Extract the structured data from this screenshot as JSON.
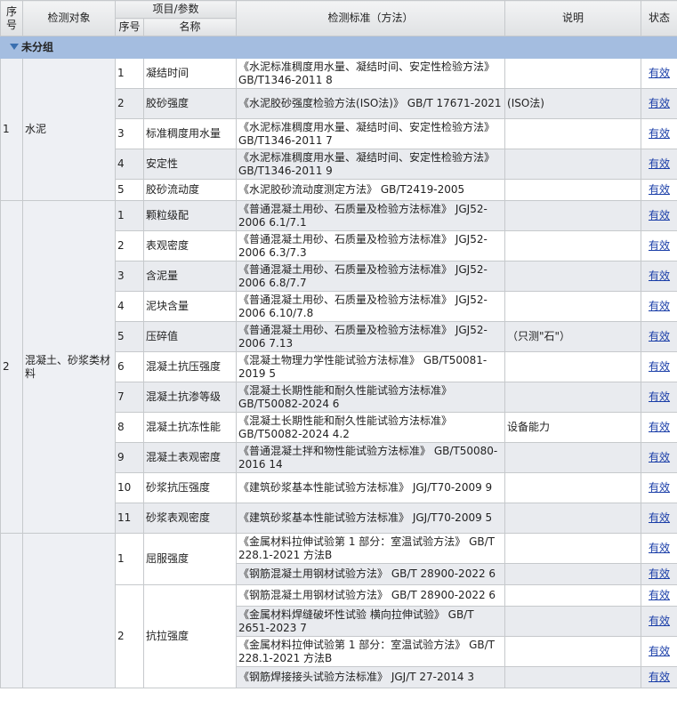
{
  "headers": {
    "seq": "序号",
    "object": "检测对象",
    "item_param": "项目/参数",
    "item_no": "序号",
    "item_name": "名称",
    "standard": "检测标准（方法）",
    "note": "说明",
    "status": "状态"
  },
  "group_label": "未分组",
  "colors": {
    "group_bg": "#a4bde0",
    "link": "#1a3ea8",
    "header_bg": "#e6e8ea"
  },
  "objects": [
    {
      "seq": "1",
      "name": "水泥",
      "items": [
        {
          "no": "1",
          "name": "凝结时间",
          "rows": [
            {
              "std": "《水泥标准稠度用水量、凝结时间、安定性检验方法》 GB/T1346-2011 8",
              "note": "",
              "status": "有效",
              "lines": 2
            }
          ]
        },
        {
          "no": "2",
          "name": "胶砂强度",
          "rows": [
            {
              "std": "《水泥胶砂强度检验方法(ISO法)》 GB/T 17671-2021",
              "note": "(ISO法)",
              "status": "有效",
              "lines": 2
            }
          ]
        },
        {
          "no": "3",
          "name": "标准稠度用水量",
          "rows": [
            {
              "std": "《水泥标准稠度用水量、凝结时间、安定性检验方法》 GB/T1346-2011 7",
              "note": "",
              "status": "有效",
              "lines": 2
            }
          ]
        },
        {
          "no": "4",
          "name": "安定性",
          "rows": [
            {
              "std": "《水泥标准稠度用水量、凝结时间、安定性检验方法》 GB/T1346-2011 9",
              "note": "",
              "status": "有效",
              "lines": 2
            }
          ]
        },
        {
          "no": "5",
          "name": "胶砂流动度",
          "rows": [
            {
              "std": "《水泥胶砂流动度测定方法》 GB/T2419-2005",
              "note": "",
              "status": "有效",
              "lines": 1
            }
          ]
        }
      ]
    },
    {
      "seq": "2",
      "name": "混凝土、砂浆类材料",
      "items": [
        {
          "no": "1",
          "name": "颗粒级配",
          "rows": [
            {
              "std": "《普通混凝土用砂、石质量及检验方法标准》 JGJ52-2006 6.1/7.1",
              "note": "",
              "status": "有效",
              "lines": 2
            }
          ]
        },
        {
          "no": "2",
          "name": "表观密度",
          "rows": [
            {
              "std": "《普通混凝土用砂、石质量及检验方法标准》 JGJ52-2006 6.3/7.3",
              "note": "",
              "status": "有效",
              "lines": 2
            }
          ]
        },
        {
          "no": "3",
          "name": "含泥量",
          "rows": [
            {
              "std": "《普通混凝土用砂、石质量及检验方法标准》 JGJ52-2006 6.8/7.7",
              "note": "",
              "status": "有效",
              "lines": 2
            }
          ]
        },
        {
          "no": "4",
          "name": "泥块含量",
          "rows": [
            {
              "std": "《普通混凝土用砂、石质量及检验方法标准》 JGJ52-2006 6.10/7.8",
              "note": "",
              "status": "有效",
              "lines": 2
            }
          ]
        },
        {
          "no": "5",
          "name": "压碎值",
          "rows": [
            {
              "std": "《普通混凝土用砂、石质量及检验方法标准》 JGJ52-2006 7.13",
              "note": "（只测\"石\"）",
              "status": "有效",
              "lines": 2
            }
          ]
        },
        {
          "no": "6",
          "name": "混凝土抗压强度",
          "rows": [
            {
              "std": "《混凝土物理力学性能试验方法标准》 GB/T50081-2019 5",
              "note": "",
              "status": "有效",
              "lines": 2
            }
          ]
        },
        {
          "no": "7",
          "name": "混凝土抗渗等级",
          "rows": [
            {
              "std": "《混凝土长期性能和耐久性能试验方法标准》 GB/T50082-2024 6",
              "note": "",
              "status": "有效",
              "lines": 2
            }
          ]
        },
        {
          "no": "8",
          "name": "混凝土抗冻性能",
          "rows": [
            {
              "std": "《混凝土长期性能和耐久性能试验方法标准》 GB/T50082-2024 4.2",
              "note": "设备能力",
              "status": "有效",
              "lines": 2
            }
          ]
        },
        {
          "no": "9",
          "name": "混凝土表观密度",
          "rows": [
            {
              "std": "《普通混凝土拌和物性能试验方法标准》 GB/T50080-2016 14",
              "note": "",
              "status": "有效",
              "lines": 2
            }
          ]
        },
        {
          "no": "10",
          "name": "砂浆抗压强度",
          "rows": [
            {
              "std": "《建筑砂浆基本性能试验方法标准》 JGJ/T70-2009 9",
              "note": "",
              "status": "有效",
              "lines": 2
            }
          ]
        },
        {
          "no": "11",
          "name": "砂浆表观密度",
          "rows": [
            {
              "std": "《建筑砂浆基本性能试验方法标准》 JGJ/T70-2009 5",
              "note": "",
              "status": "有效",
              "lines": 2
            }
          ]
        }
      ]
    },
    {
      "seq": "",
      "name": "",
      "items": [
        {
          "no": "1",
          "name": "屈服强度",
          "rows": [
            {
              "std": "《金属材料拉伸试验第 1 部分：室温试验方法》 GB/T 228.1-2021 方法B",
              "note": "",
              "status": "有效",
              "lines": 2
            },
            {
              "std": "《钢筋混凝土用钢材试验方法》 GB/T 28900-2022 6",
              "note": "",
              "status": "有效",
              "lines": 1
            }
          ]
        },
        {
          "no": "2",
          "name": "抗拉强度",
          "rows": [
            {
              "std": "《钢筋混凝土用钢材试验方法》 GB/T 28900-2022 6",
              "note": "",
              "status": "有效",
              "lines": 1
            },
            {
              "std": "《金属材料焊缝破坏性试验 横向拉伸试验》 GB/T 2651-2023 7",
              "note": "",
              "status": "有效",
              "lines": 2
            },
            {
              "std": "《金属材料拉伸试验第 1 部分：室温试验方法》 GB/T 228.1-2021 方法B",
              "note": "",
              "status": "有效",
              "lines": 2
            },
            {
              "std": "《钢筋焊接接头试验方法标准》 JGJ/T 27-2014 3",
              "note": "",
              "status": "有效",
              "lines": 1
            }
          ]
        }
      ]
    }
  ]
}
